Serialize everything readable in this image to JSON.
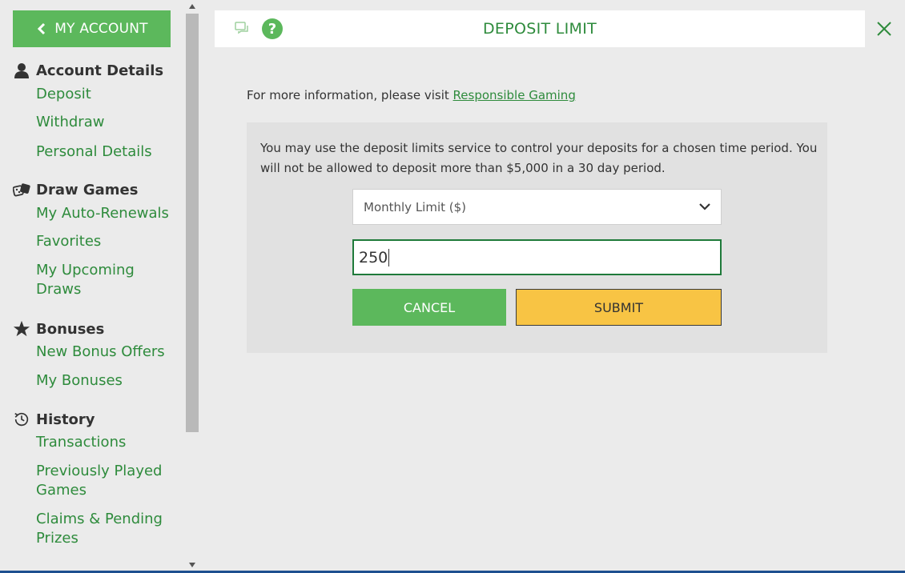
{
  "sidebar": {
    "my_account_label": "MY ACCOUNT",
    "sections": [
      {
        "title": "Account Details",
        "icon": "user-icon",
        "items": [
          "Deposit",
          "Withdraw",
          "Personal Details"
        ]
      },
      {
        "title": "Draw Games",
        "icon": "dice-icon",
        "items": [
          "My Auto-Renewals",
          "Favorites",
          "My Upcoming Draws"
        ]
      },
      {
        "title": "Bonuses",
        "icon": "star-icon",
        "items": [
          "New Bonus Offers",
          "My Bonuses"
        ]
      },
      {
        "title": "History",
        "icon": "history-icon",
        "items": [
          "Transactions",
          "Previously Played Games",
          "Claims & Pending Prizes"
        ]
      }
    ]
  },
  "header": {
    "title": "DEPOSIT LIMIT",
    "help_glyph": "?"
  },
  "info": {
    "prefix": "For more information, please visit ",
    "link_text": "Responsible Gaming"
  },
  "form": {
    "description": "You may use the deposit limits service to control your deposits for a chosen time period. You will not be allowed to deposit more than $5,000 in a 30 day period.",
    "limit_type_selected": "Monthly Limit ($)",
    "amount_value": "250",
    "cancel_label": "CANCEL",
    "submit_label": "SUBMIT"
  },
  "colors": {
    "brand_green": "#5cb85c",
    "text_green": "#2e8b3c",
    "submit_yellow": "#f8c444"
  }
}
